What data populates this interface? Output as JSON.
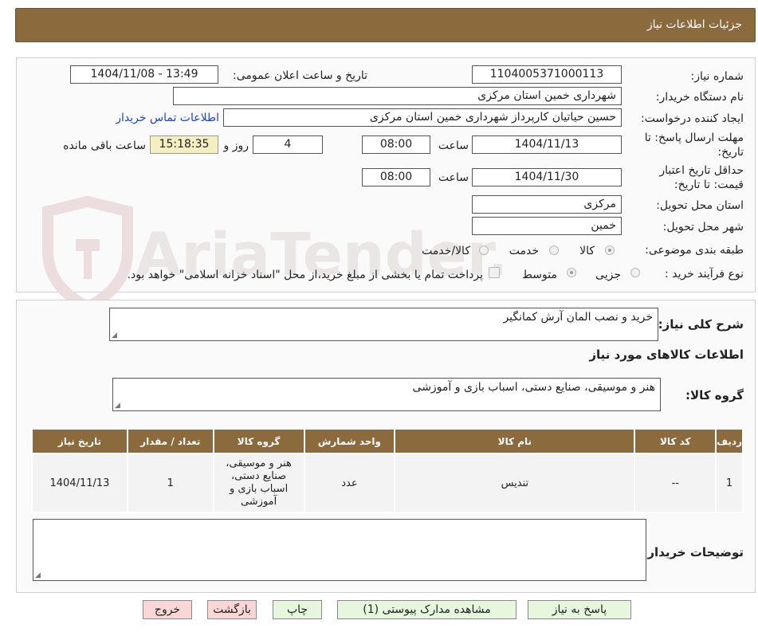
{
  "header": {
    "title": "جزئیات اطلاعات نیاز"
  },
  "form": {
    "need_number_label": "شماره نیاز:",
    "need_number": "1104005371000113",
    "announce_label": "تاریخ و ساعت اعلان عمومی:",
    "announce_value": "1404/11/08 - 13:49",
    "buyer_org_label": "نام دستگاه خریدار:",
    "buyer_org": "شهرداری خمین استان مرکزی",
    "creator_label": "ایجاد کننده درخواست:",
    "creator": "حسین حیاتیان کارپرداز شهرداری خمین استان مرکزی",
    "contact_link": "اطلاعات تماس خریدار",
    "deadline_label_1": "مهلت ارسال پاسخ: تا",
    "deadline_label_2": "تاریخ:",
    "deadline_date": "1404/11/13",
    "time_label": "ساعت",
    "deadline_time": "08:00",
    "days_value": "4",
    "days_label": "روز و",
    "remaining_time": "15:18:35",
    "remaining_label": "ساعت باقی مانده",
    "validity_label_1": "حداقل تاریخ اعتبار",
    "validity_label_2": "قیمت: تا تاریخ:",
    "validity_date": "1404/11/30",
    "validity_time": "08:00",
    "province_label": "استان محل تحویل:",
    "province": "مرکزی",
    "city_label": "شهر محل تحویل:",
    "city": "خمین",
    "category_label": "طبقه بندی موضوعی:",
    "category_options": [
      "کالا",
      "خدمت",
      "کالا/خدمت"
    ],
    "process_label": "نوع فرآیند خرید :",
    "process_options": [
      "جزیی",
      "متوسط"
    ],
    "payment_note": "پرداخت تمام یا بخشی از مبلغ خرید،از محل \"اسناد خزانه اسلامی\" خواهد بود."
  },
  "summary": {
    "label": "شرح کلی نیاز:",
    "value": "خرید و نصب المان آرش کمانگیر",
    "goods_info_title": "اطلاعات کالاهای مورد نیاز",
    "group_label": "گروه کالا:",
    "group_value": "هنر و موسیقی، صنایع دستی، اسباب بازی و آموزشی"
  },
  "table": {
    "headers": [
      "ردیف",
      "کد کالا",
      "نام کالا",
      "واحد شمارش",
      "گروه کالا",
      "تعداد / مقدار",
      "تاریخ نیاز"
    ],
    "rows": [
      {
        "row": "1",
        "code": "--",
        "name": "تندیس",
        "unit": "عدد",
        "group": "هنر و موسیقی، صنایع دستی، اسباب بازی و آموزشی",
        "qty": "1",
        "date": "1404/11/13"
      }
    ]
  },
  "notes": {
    "label": "توضیحات خریدار:",
    "value": ""
  },
  "buttons": {
    "reply": "پاسخ به نیاز",
    "attachments": "مشاهده مدارک پیوستی (1)",
    "print": "چاپ",
    "back": "بازگشت",
    "exit": "خروج"
  },
  "watermark": {
    "text": "AriaTender.neT",
    "color": "#e9e4e4"
  }
}
